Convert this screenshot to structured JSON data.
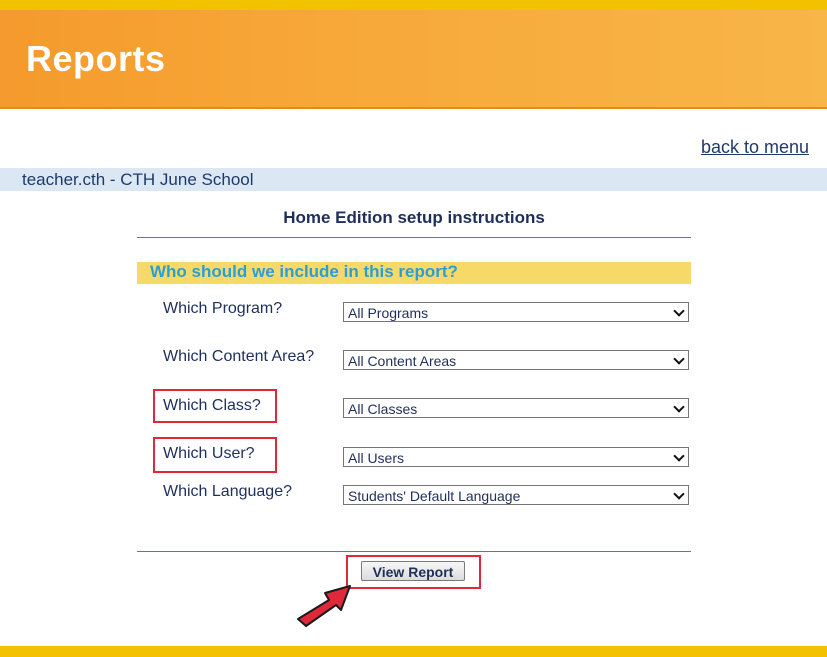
{
  "header": {
    "title": "Reports"
  },
  "nav": {
    "back_link": "back to menu"
  },
  "user_bar": {
    "text": "teacher.cth - CTH June School"
  },
  "section": {
    "title": "Home Edition setup instructions"
  },
  "include": {
    "heading": "Who should we include in this report?"
  },
  "filters": [
    {
      "label": "Which Program?",
      "value": "All Programs"
    },
    {
      "label": "Which Content Area?",
      "value": "All Content Areas"
    },
    {
      "label": "Which Class?",
      "value": "All Classes"
    },
    {
      "label": "Which User?",
      "value": "All Users"
    },
    {
      "label": "Which Language?",
      "value": "Students' Default Language"
    }
  ],
  "actions": {
    "view_report": "View Report"
  },
  "colors": {
    "header_orange": "#f7a838",
    "highlight_red": "#e0283b",
    "include_bar_yellow": "#f7d96a",
    "include_text_blue": "#2a9fd6"
  },
  "icons": {
    "pointer": "red-arrow-icon",
    "select": "chevron-down-icon"
  }
}
